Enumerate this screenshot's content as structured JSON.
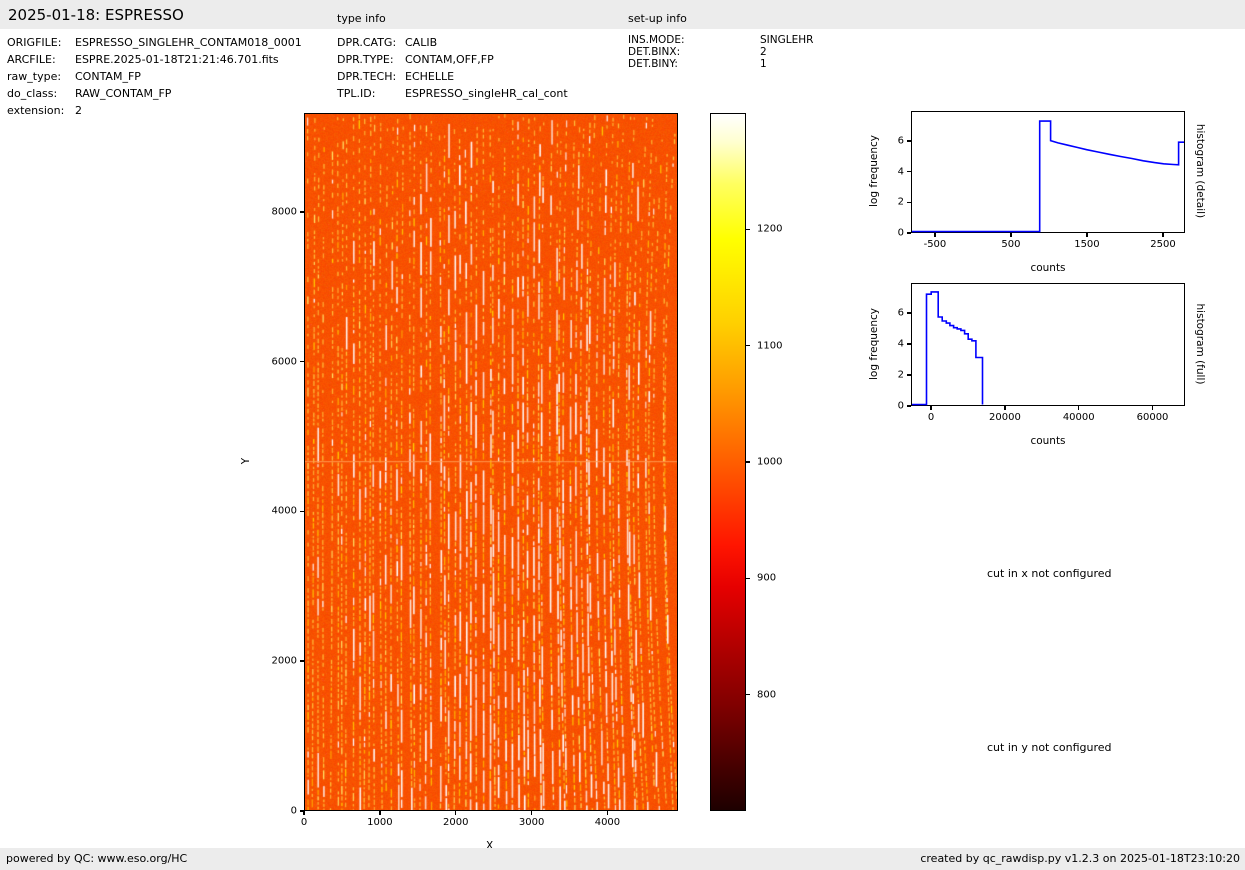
{
  "header": {
    "title": "2025-01-18: ESPRESSO",
    "type_info": "type info",
    "setup_info": "set-up info"
  },
  "file_info": {
    "rows": [
      {
        "label": "ORIGFILE:",
        "value": "ESPRESSO_SINGLEHR_CONTAM018_0001"
      },
      {
        "label": "ARCFILE:",
        "value": "ESPRE.2025-01-18T21:21:46.701.fits"
      },
      {
        "label": "raw_type:",
        "value": "CONTAM_FP"
      },
      {
        "label": "do_class:",
        "value": "RAW_CONTAM_FP"
      },
      {
        "label": "extension:",
        "value": "2"
      }
    ]
  },
  "type_info": {
    "rows": [
      {
        "label": "DPR.CATG:",
        "value": "CALIB"
      },
      {
        "label": "DPR.TYPE:",
        "value": "CONTAM,OFF,FP"
      },
      {
        "label": "DPR.TECH:",
        "value": "ECHELLE"
      },
      {
        "label": "TPL.ID:",
        "value": "ESPRESSO_singleHR_cal_cont"
      }
    ]
  },
  "setup_info": {
    "rows": [
      {
        "label": "INS.MODE:",
        "value": "SINGLEHR"
      },
      {
        "label": "DET.BINX:",
        "value": "2"
      },
      {
        "label": "DET.BINY:",
        "value": "1"
      }
    ]
  },
  "messages": {
    "cut_x": "cut in x not configured",
    "cut_y": "cut in y not configured"
  },
  "footer": {
    "left": "powered by QC: www.eso.org/HC",
    "right": "created by qc_rawdisp.py v1.2.3 on 2025-01-18T23:10:20"
  },
  "chart_data": [
    {
      "type": "heatmap",
      "name": "raw-image",
      "xlabel": "X",
      "ylabel": "Y",
      "xlim": [
        0,
        4930
      ],
      "ylim": [
        0,
        9320
      ],
      "x_ticks": [
        0,
        1000,
        2000,
        3000,
        4000
      ],
      "y_ticks": [
        0,
        2000,
        4000,
        6000,
        8000
      ],
      "colormap": "hot",
      "colorbar": {
        "range": [
          700,
          1300
        ],
        "ticks": [
          800,
          900,
          1000,
          1100,
          1200
        ],
        "gradient": [
          {
            "at": 0,
            "color": "#ffffff"
          },
          {
            "at": 4,
            "color": "#ffffd0"
          },
          {
            "at": 10,
            "color": "#ffff60"
          },
          {
            "at": 18,
            "color": "#ffff00"
          },
          {
            "at": 30,
            "color": "#ffd000"
          },
          {
            "at": 40,
            "color": "#ff9900"
          },
          {
            "at": 48,
            "color": "#ff6a00"
          },
          {
            "at": 55,
            "color": "#ff4000"
          },
          {
            "at": 62,
            "color": "#ff1500"
          },
          {
            "at": 68,
            "color": "#e60000"
          },
          {
            "at": 76,
            "color": "#b40000"
          },
          {
            "at": 85,
            "color": "#800000"
          },
          {
            "at": 93,
            "color": "#4b0000"
          },
          {
            "at": 100,
            "color": "#1e0000"
          }
        ]
      },
      "texture": {
        "base_rgb": [
          247,
          80,
          0
        ],
        "dash_colors": [
          "#ffae00",
          "#ffd000",
          "#ffec6a",
          "#ffffff"
        ],
        "dot_color": "#ffc13a",
        "streak_color": "#ffffff",
        "hline_color": "#ff9a50",
        "hline_frac": 0.498,
        "n_orders": 66
      },
      "description": "ESPRESSO raw CONTAM_FP echelle frame: orange background near 1000 counts with bright Fabry-Perot emission dashes along ~66 slightly curved vertical orders; brighter horizontal detector row near Y=4650; background level ~950-1000 counts, bright spots up to saturation."
    },
    {
      "type": "line",
      "name": "histogram-detail",
      "right_label": "histogram (detail)",
      "xlabel": "counts",
      "ylabel": "log frequency",
      "xlim": [
        -815,
        2790
      ],
      "ylim": [
        0,
        7.95
      ],
      "x_ticks": [
        -500,
        500,
        1500,
        2500
      ],
      "y_ticks": [
        0,
        2,
        4,
        6
      ],
      "line_color": "#0000ff",
      "points": [
        [
          -815,
          0.03
        ],
        [
          878,
          0.03
        ],
        [
          878,
          7.35
        ],
        [
          1022,
          7.35
        ],
        [
          1022,
          6.05
        ],
        [
          1120,
          5.9
        ],
        [
          1250,
          5.75
        ],
        [
          1380,
          5.6
        ],
        [
          1500,
          5.45
        ],
        [
          1650,
          5.3
        ],
        [
          1800,
          5.15
        ],
        [
          1950,
          5.0
        ],
        [
          2100,
          4.87
        ],
        [
          2250,
          4.72
        ],
        [
          2400,
          4.6
        ],
        [
          2520,
          4.52
        ],
        [
          2650,
          4.47
        ],
        [
          2718,
          4.45
        ],
        [
          2718,
          5.95
        ],
        [
          2790,
          5.95
        ]
      ]
    },
    {
      "type": "line",
      "name": "histogram-full",
      "right_label": "histogram (full)",
      "xlabel": "counts",
      "ylabel": "log frequency",
      "xlim": [
        -5450,
        68800
      ],
      "ylim": [
        0,
        7.95
      ],
      "x_ticks": [
        0,
        20000,
        40000,
        60000
      ],
      "y_ticks": [
        0,
        2,
        4,
        6
      ],
      "line_color": "#0000ff",
      "points": [
        [
          -5450,
          0.03
        ],
        [
          -1500,
          0.03
        ],
        [
          -1500,
          7.28
        ],
        [
          -200,
          7.28
        ],
        [
          -200,
          7.43
        ],
        [
          1700,
          7.43
        ],
        [
          1700,
          5.78
        ],
        [
          2800,
          5.78
        ],
        [
          2800,
          5.52
        ],
        [
          3900,
          5.52
        ],
        [
          3900,
          5.38
        ],
        [
          4900,
          5.38
        ],
        [
          4900,
          5.22
        ],
        [
          5900,
          5.22
        ],
        [
          5900,
          5.08
        ],
        [
          6900,
          5.08
        ],
        [
          6900,
          5.0
        ],
        [
          7900,
          5.0
        ],
        [
          7900,
          4.9
        ],
        [
          8900,
          4.9
        ],
        [
          8900,
          4.68
        ],
        [
          9900,
          4.68
        ],
        [
          9900,
          4.32
        ],
        [
          10900,
          4.32
        ],
        [
          10900,
          4.22
        ],
        [
          12000,
          4.22
        ],
        [
          12000,
          3.12
        ],
        [
          13800,
          3.12
        ],
        [
          13800,
          0.03
        ]
      ]
    }
  ]
}
